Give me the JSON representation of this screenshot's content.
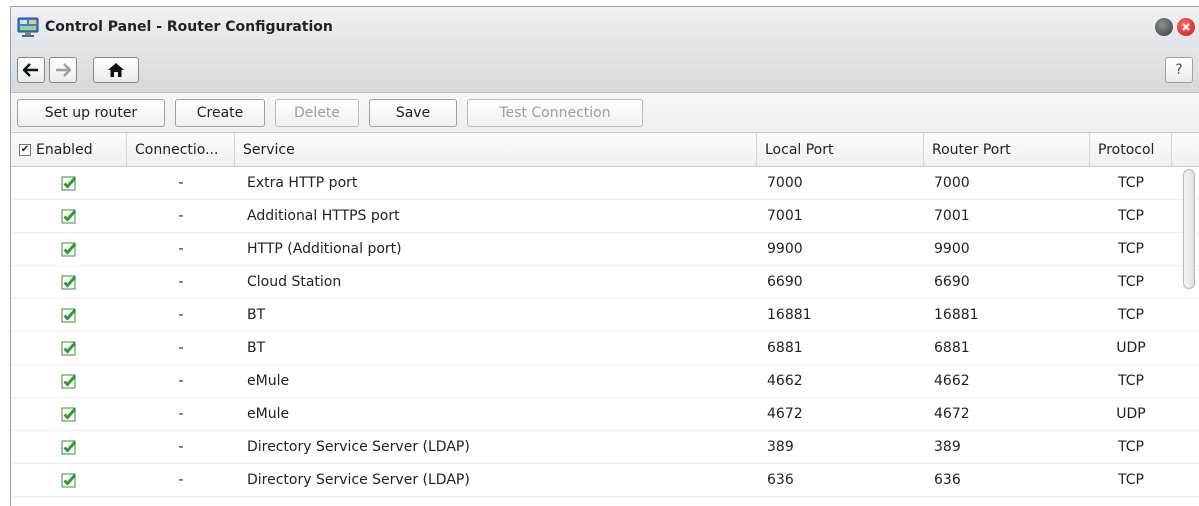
{
  "window": {
    "title": "Control Panel - Router Configuration",
    "icon": "control-panel-icon"
  },
  "nav": {
    "back_icon": "arrow-left-icon",
    "forward_icon": "arrow-right-icon",
    "home_icon": "home-icon",
    "help_label": "?"
  },
  "toolbar": {
    "setup_label": "Set up router",
    "create_label": "Create",
    "delete_label": "Delete",
    "save_label": "Save",
    "test_label": "Test Connection"
  },
  "table": {
    "headers": {
      "enabled": "Enabled",
      "connection": "Connectio...",
      "service": "Service",
      "local_port": "Local Port",
      "router_port": "Router Port",
      "protocol": "Protocol"
    },
    "rows": [
      {
        "enabled": true,
        "connection": "-",
        "service": "Extra HTTP port",
        "local_port": "7000",
        "router_port": "7000",
        "protocol": "TCP"
      },
      {
        "enabled": true,
        "connection": "-",
        "service": "Additional HTTPS port",
        "local_port": "7001",
        "router_port": "7001",
        "protocol": "TCP"
      },
      {
        "enabled": true,
        "connection": "-",
        "service": "HTTP (Additional port)",
        "local_port": "9900",
        "router_port": "9900",
        "protocol": "TCP"
      },
      {
        "enabled": true,
        "connection": "-",
        "service": "Cloud Station",
        "local_port": "6690",
        "router_port": "6690",
        "protocol": "TCP"
      },
      {
        "enabled": true,
        "connection": "-",
        "service": "BT",
        "local_port": "16881",
        "router_port": "16881",
        "protocol": "TCP"
      },
      {
        "enabled": true,
        "connection": "-",
        "service": "BT",
        "local_port": "6881",
        "router_port": "6881",
        "protocol": "UDP"
      },
      {
        "enabled": true,
        "connection": "-",
        "service": "eMule",
        "local_port": "4662",
        "router_port": "4662",
        "protocol": "TCP"
      },
      {
        "enabled": true,
        "connection": "-",
        "service": "eMule",
        "local_port": "4672",
        "router_port": "4672",
        "protocol": "UDP"
      },
      {
        "enabled": true,
        "connection": "-",
        "service": "Directory Service Server (LDAP)",
        "local_port": "389",
        "router_port": "389",
        "protocol": "TCP"
      },
      {
        "enabled": true,
        "connection": "-",
        "service": "Directory Service Server (LDAP)",
        "local_port": "636",
        "router_port": "636",
        "protocol": "TCP"
      }
    ]
  },
  "colors": {
    "check_green": "#3aa53a",
    "title_bar": "#e6e9ec"
  }
}
